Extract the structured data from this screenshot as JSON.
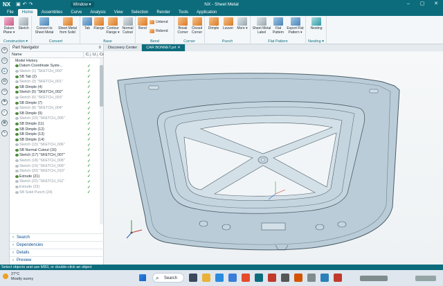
{
  "app": {
    "logo": "NX",
    "title": "NX - Sheet Metal",
    "window_menu": "Window ▾"
  },
  "menu": [
    "File",
    "Home",
    "Assemblies",
    "Curve",
    "Analysis",
    "View",
    "Selection",
    "Render",
    "Tools",
    "Application"
  ],
  "menu_active": "Home",
  "ribbon": {
    "construction": {
      "label": "Construction ▾",
      "buttons": [
        "Datum Plane ▾",
        "Sketch"
      ]
    },
    "convert": {
      "label": "Convert",
      "buttons": [
        "Convert to Sheet Metal",
        "Sheet Metal from Solid"
      ]
    },
    "base": {
      "label": "Base",
      "buttons": [
        "Tab",
        "Flange",
        "Contour Flange ▾",
        "Normal Cutout"
      ]
    },
    "bend": {
      "label": "Bend",
      "buttons": [
        "Bend"
      ],
      "small": [
        "Unbend",
        "Rebend"
      ]
    },
    "corner": {
      "label": "Corner",
      "buttons": [
        "Break Corner",
        "Closed Corner"
      ]
    },
    "punch": {
      "label": "Punch",
      "buttons": [
        "Dimple",
        "Louver",
        "More ▾"
      ]
    },
    "flat": {
      "label": "Flat Pattern",
      "buttons": [
        "Sheet Metal Label",
        "Flat Pattern",
        "Export Flat Pattern ▾"
      ]
    },
    "nesting": {
      "label": "Nesting ▾",
      "buttons": [
        "Nesting"
      ]
    }
  },
  "navigator": {
    "title": "Part Navigator",
    "columns": [
      "Name",
      "C...",
      "U...",
      "Com"
    ],
    "items": [
      {
        "label": "Model History",
        "dim": false
      },
      {
        "label": "Datum Coordinate Syste...",
        "dim": false
      },
      {
        "label": "Sketch (1) \"SKETCH_000\"",
        "dim": true
      },
      {
        "label": "SB Tab (2)",
        "dim": false
      },
      {
        "label": "Sketch (3) \"SKETCH_001\"",
        "dim": true
      },
      {
        "label": "SB Dimple (4)",
        "dim": false
      },
      {
        "label": "Sketch (5) \"SKETCH_002\"",
        "dim": false
      },
      {
        "label": "Sketch (6) \"SKETCH_003\"",
        "dim": true
      },
      {
        "label": "SB Dimple (7)",
        "dim": false
      },
      {
        "label": "Sketch (8) \"SKETCH_004\"",
        "dim": true
      },
      {
        "label": "SB Dimple (9)",
        "dim": false
      },
      {
        "label": "Sketch (10) \"SKETCH_005\"",
        "dim": true
      },
      {
        "label": "SB Dimple (11)",
        "dim": false
      },
      {
        "label": "SB Dimple (12)",
        "dim": false
      },
      {
        "label": "SB Dimple (13)",
        "dim": false
      },
      {
        "label": "SB Dimple (14)",
        "dim": false
      },
      {
        "label": "Sketch (15) \"SKETCH_006\"",
        "dim": true
      },
      {
        "label": "SB Normal Cutout (16)",
        "dim": false
      },
      {
        "label": "Sketch (17) \"SKETCH_007\"",
        "dim": false
      },
      {
        "label": "Sketch (18) \"SKETCH_008\"",
        "dim": true
      },
      {
        "label": "Sketch (19) \"SKETCH_009\"",
        "dim": true
      },
      {
        "label": "Sketch (20) \"SKETCH_010\"",
        "dim": true
      },
      {
        "label": "Extrude (21)",
        "dim": false
      },
      {
        "label": "Sketch (22) \"SKETCH_011\"",
        "dim": true
      },
      {
        "label": "Extrude (23)",
        "dim": true
      },
      {
        "label": "SB Solid Punch (24)",
        "dim": true
      }
    ],
    "check": "✓",
    "panes": [
      "Search",
      "Dependencies",
      "Details",
      "Preview"
    ]
  },
  "doc_tabs": [
    "Discovery Center",
    "CAR BONNET.prt ✕"
  ],
  "status_text": "Select objects and use MB3, or double-click an object",
  "taskbar": {
    "temperature": "27°C",
    "weather": "Mostly sunny",
    "search": "Search"
  },
  "colors": {
    "accent": "#0c6c7c",
    "part": "#b9ccd8",
    "part_edge": "#4a5c66"
  }
}
